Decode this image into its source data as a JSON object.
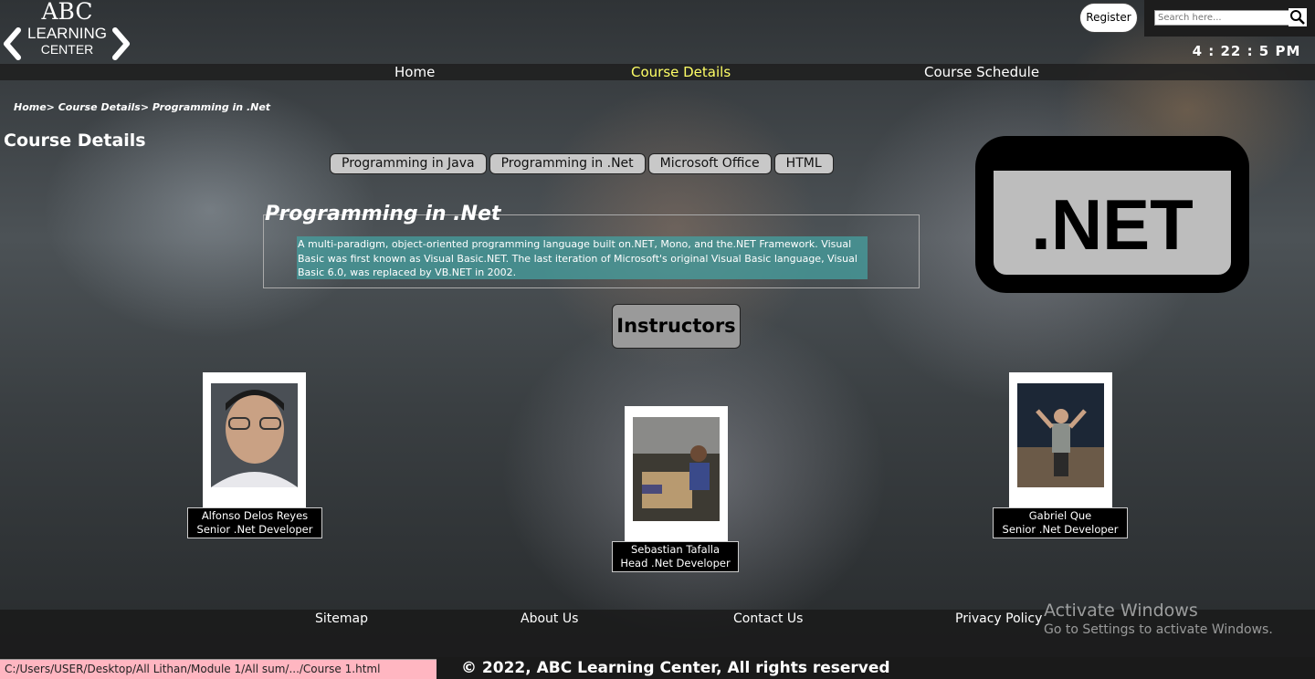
{
  "logo": {
    "line1": "ABC",
    "line2": "LEARNING",
    "line3": "CENTER"
  },
  "nav": {
    "home": "Home",
    "course_details": "Course Details",
    "course_schedule": "Course Schedule"
  },
  "header": {
    "register": "Register",
    "search_placeholder": "Search here...",
    "clock": "4 : 22 : 5 PM"
  },
  "breadcrumb": "Home> Course Details> Programming in .Net",
  "page_title": "Course Details",
  "course_tabs": [
    "Programming in Java",
    "Programming in .Net",
    "Microsoft Office",
    "HTML"
  ],
  "course": {
    "heading": "Programming in .Net",
    "description": "A multi-paradigm, object-oriented programming language built on.NET, Mono, and the.NET Framework. Visual Basic was first known as Visual Basic.NET. The last iteration of Microsoft's original Visual Basic language, Visual Basic 6.0, was replaced by VB.NET in 2002.",
    "logo_text": ".NET"
  },
  "instructors": {
    "button": "Instructors",
    "list": [
      {
        "name": "Alfonso Delos Reyes",
        "role": "Senior .Net Developer"
      },
      {
        "name": "Sebastian Tafalla",
        "role": "Head .Net Developer"
      },
      {
        "name": "Gabriel Que",
        "role": "Senior .Net Developer"
      }
    ]
  },
  "footer": {
    "sitemap": "Sitemap",
    "about": "About Us",
    "contact": "Contact Us",
    "privacy": "Privacy Policy",
    "copyright": "© 2022, ABC Learning Center, All rights reserved"
  },
  "windows_watermark": {
    "title": "Activate Windows",
    "subtitle": "Go to Settings to activate Windows."
  },
  "status_url": "C:/Users/USER/Desktop/All Lithan/Module 1/All sum/.../Course 1.html",
  "colors": {
    "active_nav": "#ffff66",
    "desc_bg": "#46a0a0",
    "status_bar": "#ffb6c1"
  }
}
